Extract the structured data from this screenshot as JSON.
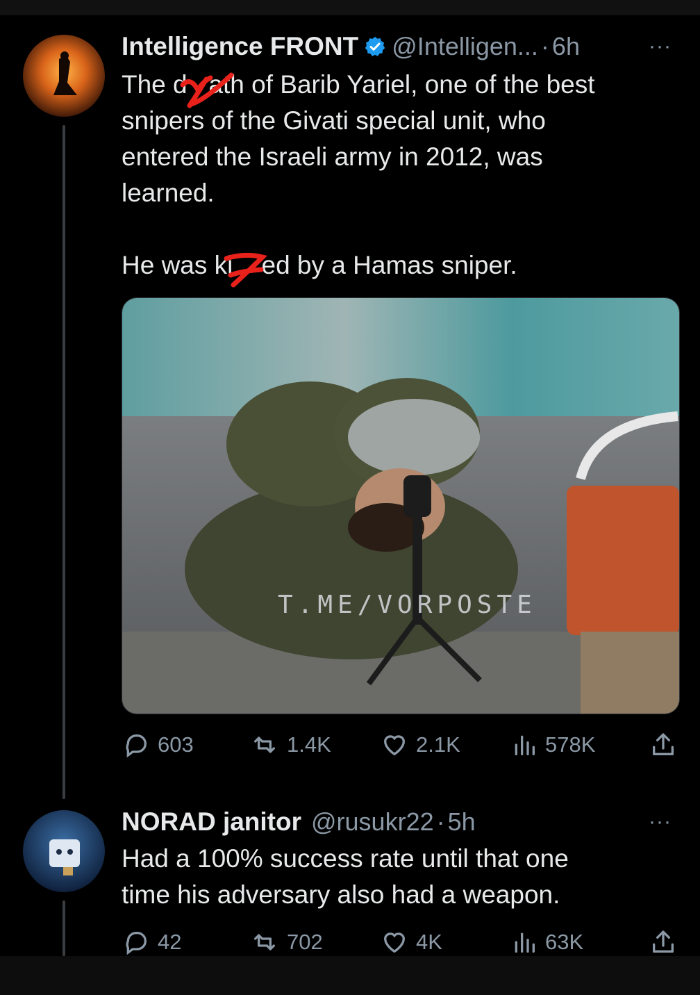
{
  "tweet1": {
    "display_name": "Intelligence FRONT",
    "handle": "@Intelligen...",
    "separator": "·",
    "time": "6h",
    "more_label": "···",
    "body_lines": [
      "The d   ath of Barib Yariel, one of the best",
      "snipers of the Givati special unit, who",
      "entered the Israeli army in 2012, was",
      "learned."
    ],
    "body_line2": "He was ki    ed by a Hamas sniper.",
    "media_watermark": "T.ME/VORPOSTE",
    "stats": {
      "replies": "603",
      "retweets": "1.4K",
      "likes": "2.1K",
      "views": "578K"
    }
  },
  "tweet2": {
    "display_name": "NORAD janitor",
    "handle": "@rusukr22",
    "separator": "·",
    "time": "5h",
    "more_label": "···",
    "body_lines": [
      "Had a 100% success rate until that one",
      "time his adversary also had a weapon."
    ],
    "stats": {
      "replies": "42",
      "retweets": "702",
      "likes": "4K",
      "views": "63K"
    }
  },
  "colors": {
    "background": "#000000",
    "text": "#e7e9ea",
    "secondary": "#8b98a5",
    "verified": "#1d9bf0",
    "scribble": "#e8221b"
  }
}
